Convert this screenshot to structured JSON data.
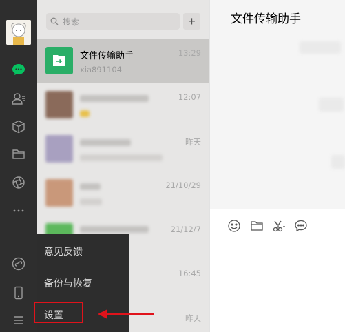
{
  "sidebar": {
    "avatar_icon": "user-avatar",
    "icons": [
      "chat-icon",
      "contacts-icon",
      "box-icon",
      "folder-icon",
      "moments-icon",
      "more-icon",
      "miniprogram-icon",
      "phone-icon",
      "menu-icon"
    ],
    "active_color": "#07c160"
  },
  "search": {
    "placeholder": "搜索",
    "add_label": "+"
  },
  "chat_list": [
    {
      "name": "文件传输助手",
      "subtitle": "xia891104",
      "time": "13:29",
      "active": true
    },
    {
      "name": "",
      "subtitle": "",
      "time": "12:07"
    },
    {
      "name": "",
      "subtitle": "",
      "time": "昨天"
    },
    {
      "name": "",
      "subtitle": "",
      "time": "21/10/29"
    },
    {
      "name": "",
      "subtitle": "",
      "time": "21/12/7"
    },
    {
      "name": "",
      "subtitle": "",
      "time": "16:45"
    },
    {
      "name": "",
      "subtitle": "",
      "time": "昨天"
    }
  ],
  "popup_menu": {
    "items": [
      "意见反馈",
      "备份与恢复",
      "设置"
    ],
    "highlighted": "设置",
    "highlight_color": "#e0131b"
  },
  "main": {
    "title": "文件传输助手",
    "toolbar": [
      "emoji-icon",
      "folder-icon",
      "scissors-icon",
      "chat-bubble-icon"
    ]
  }
}
